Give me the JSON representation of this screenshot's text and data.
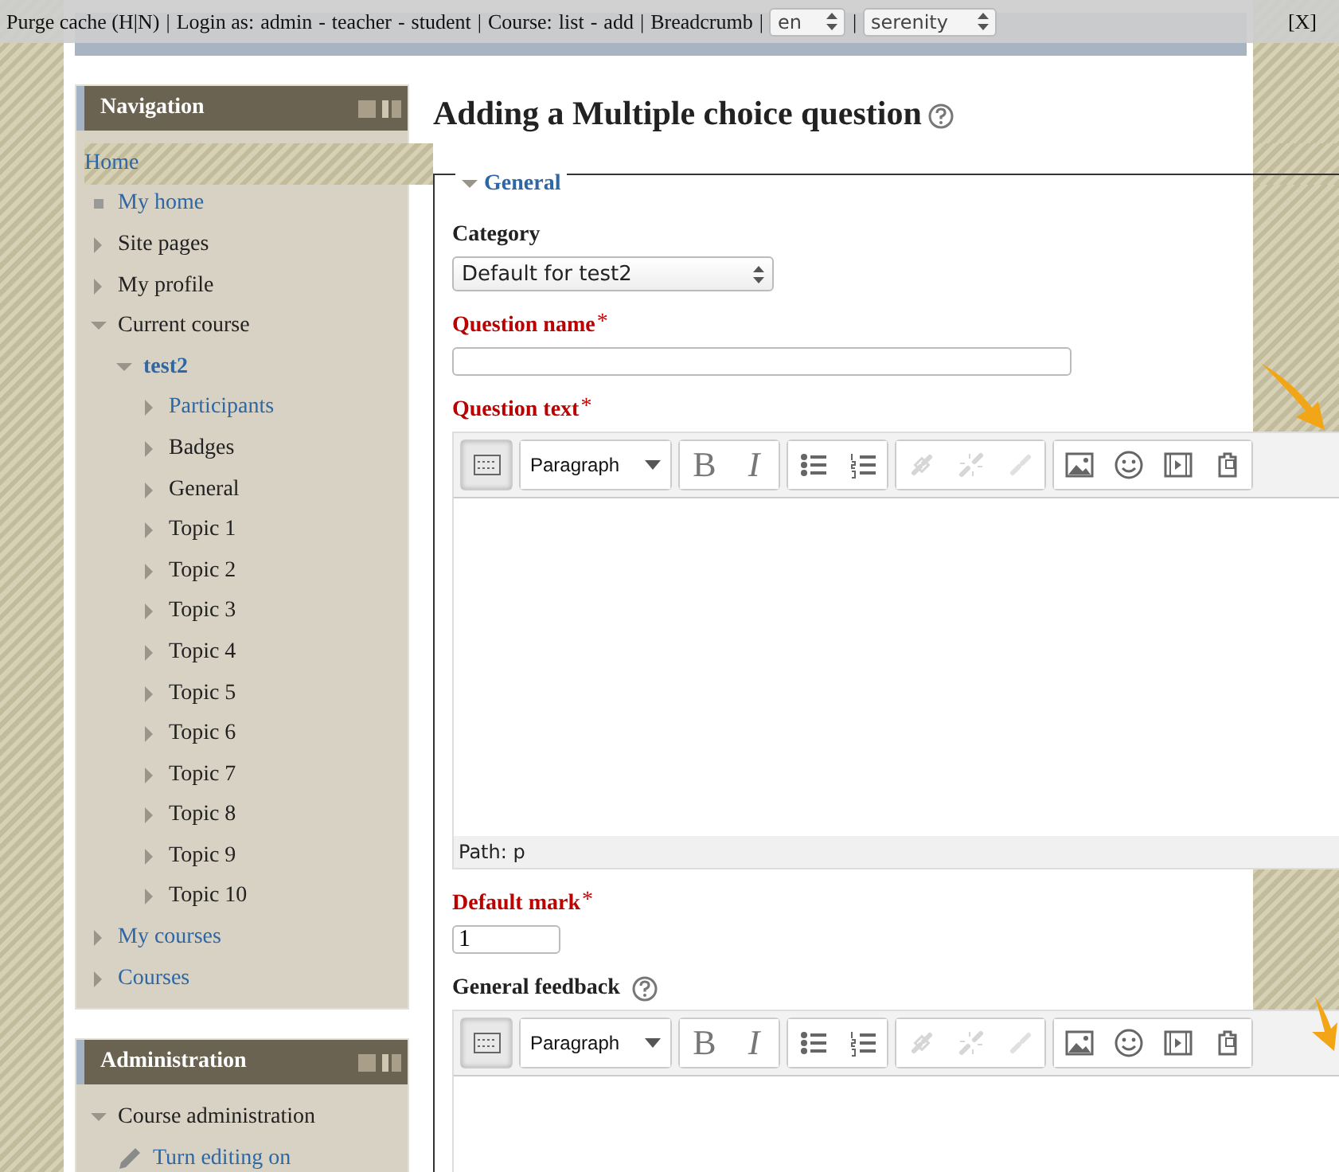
{
  "topbar": {
    "items": [
      {
        "kind": "link",
        "text": "Purge cache (H|N)"
      },
      {
        "kind": "sep",
        "text": "|"
      },
      {
        "kind": "text",
        "text": "Login as:"
      },
      {
        "kind": "link",
        "text": "admin"
      },
      {
        "kind": "text",
        "text": "-"
      },
      {
        "kind": "link",
        "text": "teacher"
      },
      {
        "kind": "text",
        "text": "-"
      },
      {
        "kind": "link",
        "text": "student"
      },
      {
        "kind": "sep",
        "text": "|"
      },
      {
        "kind": "text",
        "text": "Course:"
      },
      {
        "kind": "link",
        "text": "list"
      },
      {
        "kind": "text",
        "text": "-"
      },
      {
        "kind": "link",
        "text": "add"
      },
      {
        "kind": "sep",
        "text": "|"
      },
      {
        "kind": "link",
        "text": "Breadcrumb"
      },
      {
        "kind": "sep",
        "text": "|"
      },
      {
        "kind": "select",
        "text": "en"
      },
      {
        "kind": "sep",
        "text": "|"
      },
      {
        "kind": "select",
        "text": "serenity"
      }
    ],
    "close": "[X]"
  },
  "navigation": {
    "title": "Navigation",
    "items": [
      {
        "label": "Home",
        "kind": "root",
        "link": true,
        "active": false
      },
      {
        "label": "My home",
        "kind": "leaf",
        "link": true,
        "active": false
      },
      {
        "label": "Site pages",
        "kind": "branch",
        "expanded": false,
        "link": false,
        "active": false
      },
      {
        "label": "My profile",
        "kind": "branch",
        "expanded": false,
        "link": false,
        "active": false
      },
      {
        "label": "Current course",
        "kind": "branch",
        "expanded": true,
        "link": false,
        "active": false,
        "children": [
          {
            "label": "test2",
            "kind": "branch",
            "expanded": true,
            "link": true,
            "active": true,
            "children": [
              {
                "label": "Participants",
                "kind": "branch",
                "expanded": false,
                "link": true,
                "active": false
              },
              {
                "label": "Badges",
                "kind": "branch",
                "expanded": false,
                "link": false,
                "active": false
              },
              {
                "label": "General",
                "kind": "branch",
                "expanded": false,
                "link": false,
                "active": false
              },
              {
                "label": "Topic 1",
                "kind": "branch",
                "expanded": false,
                "link": false,
                "active": false
              },
              {
                "label": "Topic 2",
                "kind": "branch",
                "expanded": false,
                "link": false,
                "active": false
              },
              {
                "label": "Topic 3",
                "kind": "branch",
                "expanded": false,
                "link": false,
                "active": false
              },
              {
                "label": "Topic 4",
                "kind": "branch",
                "expanded": false,
                "link": false,
                "active": false
              },
              {
                "label": "Topic 5",
                "kind": "branch",
                "expanded": false,
                "link": false,
                "active": false
              },
              {
                "label": "Topic 6",
                "kind": "branch",
                "expanded": false,
                "link": false,
                "active": false
              },
              {
                "label": "Topic 7",
                "kind": "branch",
                "expanded": false,
                "link": false,
                "active": false
              },
              {
                "label": "Topic 8",
                "kind": "branch",
                "expanded": false,
                "link": false,
                "active": false
              },
              {
                "label": "Topic 9",
                "kind": "branch",
                "expanded": false,
                "link": false,
                "active": false
              },
              {
                "label": "Topic 10",
                "kind": "branch",
                "expanded": false,
                "link": false,
                "active": false
              }
            ]
          }
        ]
      },
      {
        "label": "My courses",
        "kind": "branch",
        "expanded": false,
        "link": true,
        "active": false
      },
      {
        "label": "Courses",
        "kind": "branch",
        "expanded": false,
        "link": true,
        "active": false
      }
    ]
  },
  "administration": {
    "title": "Administration",
    "items": [
      {
        "label": "Course administration",
        "kind": "branch",
        "expanded": true,
        "link": false,
        "active": false,
        "children": [
          {
            "label": "Turn editing on",
            "kind": "pencil",
            "link": true,
            "active": false
          }
        ]
      }
    ]
  },
  "heading": "Adding a Multiple choice question",
  "fieldset": {
    "legend": "General",
    "expanded": true,
    "fields": [
      {
        "kind": "select",
        "label": "Category",
        "required": false,
        "value": "Default for test2"
      },
      {
        "kind": "text",
        "label": "Question name",
        "required": true
      },
      {
        "kind": "editor",
        "label": "Question text",
        "required": true,
        "path": "Path: p",
        "toolbar": [
          [
            {
              "kind": "toggle",
              "active": true,
              "disabled": false
            }
          ],
          [
            {
              "kind": "format",
              "text": "Paragraph"
            }
          ],
          [
            {
              "kind": "bold",
              "text": "B",
              "disabled": false
            },
            {
              "kind": "italic",
              "text": "I",
              "disabled": false
            }
          ],
          [
            {
              "kind": "bullets",
              "disabled": false
            },
            {
              "kind": "numbers",
              "disabled": false
            }
          ],
          [
            {
              "kind": "link",
              "disabled": true
            },
            {
              "kind": "unlink",
              "disabled": true
            },
            {
              "kind": "anchor",
              "disabled": true
            }
          ],
          [
            {
              "kind": "image",
              "disabled": false
            },
            {
              "kind": "emoticon",
              "disabled": false
            },
            {
              "kind": "media",
              "disabled": false
            },
            {
              "kind": "paste",
              "disabled": false
            }
          ]
        ]
      },
      {
        "kind": "text",
        "label": "Default mark",
        "required": true,
        "value": "1"
      },
      {
        "kind": "editor",
        "label": "General feedback",
        "required": false,
        "help": true,
        "toolbar": [
          [
            {
              "kind": "toggle",
              "active": true,
              "disabled": false
            }
          ],
          [
            {
              "kind": "format",
              "text": "Paragraph"
            }
          ],
          [
            {
              "kind": "bold",
              "text": "B",
              "disabled": false
            },
            {
              "kind": "italic",
              "text": "I",
              "disabled": false
            }
          ],
          [
            {
              "kind": "bullets",
              "disabled": false
            },
            {
              "kind": "numbers",
              "disabled": false
            }
          ],
          [
            {
              "kind": "link",
              "disabled": true
            },
            {
              "kind": "unlink",
              "disabled": true
            },
            {
              "kind": "anchor",
              "disabled": true
            }
          ],
          [
            {
              "kind": "image",
              "disabled": false
            },
            {
              "kind": "emoticon",
              "disabled": false
            },
            {
              "kind": "media",
              "disabled": false
            },
            {
              "kind": "paste",
              "disabled": false
            }
          ]
        ]
      }
    ]
  },
  "required_mark": "*"
}
